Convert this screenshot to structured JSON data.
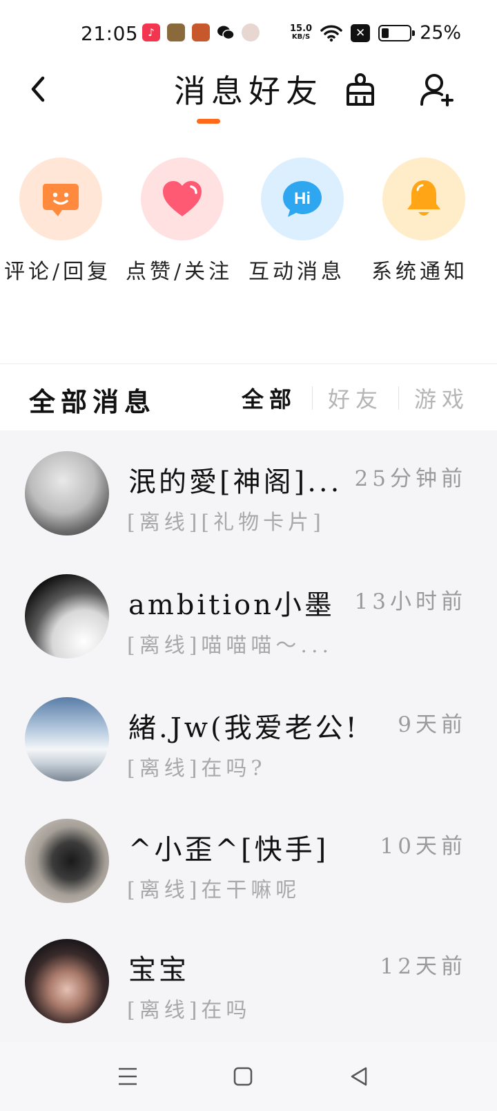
{
  "status_bar": {
    "time": "21:05",
    "net_speed": "15.0",
    "net_unit": "KB/S",
    "battery_pct": "25%",
    "battery_level": 0.25
  },
  "header": {
    "title": "消息好友",
    "accent_color": "#ff6a1a"
  },
  "categories": [
    {
      "label": "评论/回复",
      "icon": "smile-chat-icon",
      "bg": "#ffe6d6",
      "color": "#ff8a3d"
    },
    {
      "label": "点赞/关注",
      "icon": "heart-icon",
      "bg": "#ffe1e1",
      "color": "#ff5a73"
    },
    {
      "label": "互动消息",
      "icon": "hi-bubble-icon",
      "bg": "#dcefff",
      "color": "#2ea7f0"
    },
    {
      "label": "系统通知",
      "icon": "bell-icon",
      "bg": "#ffedc9",
      "color": "#ffa516"
    }
  ],
  "messages_section": {
    "title": "全部消息",
    "filters": [
      "全部",
      "好友",
      "游戏"
    ],
    "active_filter": "全部"
  },
  "messages": [
    {
      "name": "泯的愛[神阁]...",
      "time": "25分钟前",
      "preview": "[离线][礼物卡片]"
    },
    {
      "name": "ambition小墨",
      "time": "13小时前",
      "preview": "[离线]喵喵喵～..."
    },
    {
      "name": "緒.Jw(我爱老公!)",
      "time": "9天前",
      "preview": "[离线]在吗?"
    },
    {
      "name": "^小歪^[快手]",
      "time": "10天前",
      "preview": "[离线]在干嘛呢"
    },
    {
      "name": "宝宝",
      "time": "12天前",
      "preview": "[离线]在吗"
    }
  ]
}
